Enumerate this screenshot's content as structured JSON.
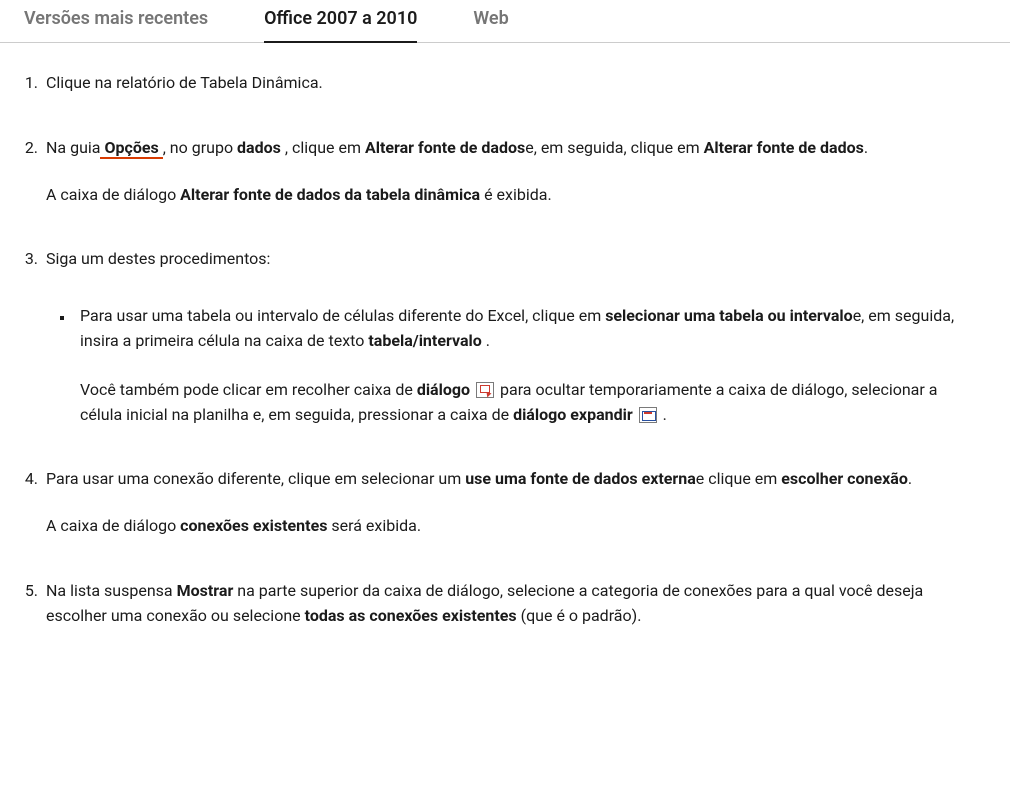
{
  "tabs": {
    "t0": "Versões mais recentes",
    "t1": "Office 2007 a 2010",
    "t2": "Web"
  },
  "steps": {
    "s1": "Clique na relatório de Tabela Dinâmica.",
    "s2": {
      "a": "Na guia",
      "opcoes": "Opções",
      "b": ", no grupo ",
      "dados": "dados",
      "c": " , clique em ",
      "alt1": "Alterar fonte de dados",
      "d": "e, em seguida, clique em ",
      "alt2": "Alterar fonte de dados",
      "e": ".",
      "p2a": "A caixa de diálogo ",
      "p2b": "Alterar fonte de dados da tabela dinâmica",
      "p2c": " é exibida."
    },
    "s3": {
      "intro": "Siga um destes procedimentos:",
      "b1a": "Para usar uma tabela ou intervalo de células diferente do Excel, clique em ",
      "b1b": "selecionar uma tabela ou intervalo",
      "b1c": "e, em seguida, insira a primeira célula na caixa de texto ",
      "b1d": "tabela/intervalo",
      "b1e": " .",
      "b2a": "Você também pode clicar em recolher caixa de ",
      "b2b": "diálogo",
      "b2c": " para ocultar temporariamente a caixa de diálogo, selecionar a célula inicial na planilha e, em seguida, pressionar a caixa de ",
      "b2d": "diálogo expandir",
      "b2e": " ."
    },
    "s4": {
      "a": "Para usar uma conexão diferente, clique em selecionar um ",
      "b": "use uma fonte de dados externa",
      "c": "e clique em ",
      "d": "escolher conexão",
      "e": ".",
      "p2a": "A caixa de diálogo ",
      "p2b": "conexões existentes",
      "p2c": " será exibida."
    },
    "s5": {
      "a": "Na lista suspensa ",
      "b": "Mostrar",
      "c": " na parte superior da caixa de diálogo, selecione a categoria de conexões para a qual você deseja escolher uma conexão ou selecione ",
      "d": "todas as conexões existentes",
      "e": " (que é o padrão)."
    }
  }
}
